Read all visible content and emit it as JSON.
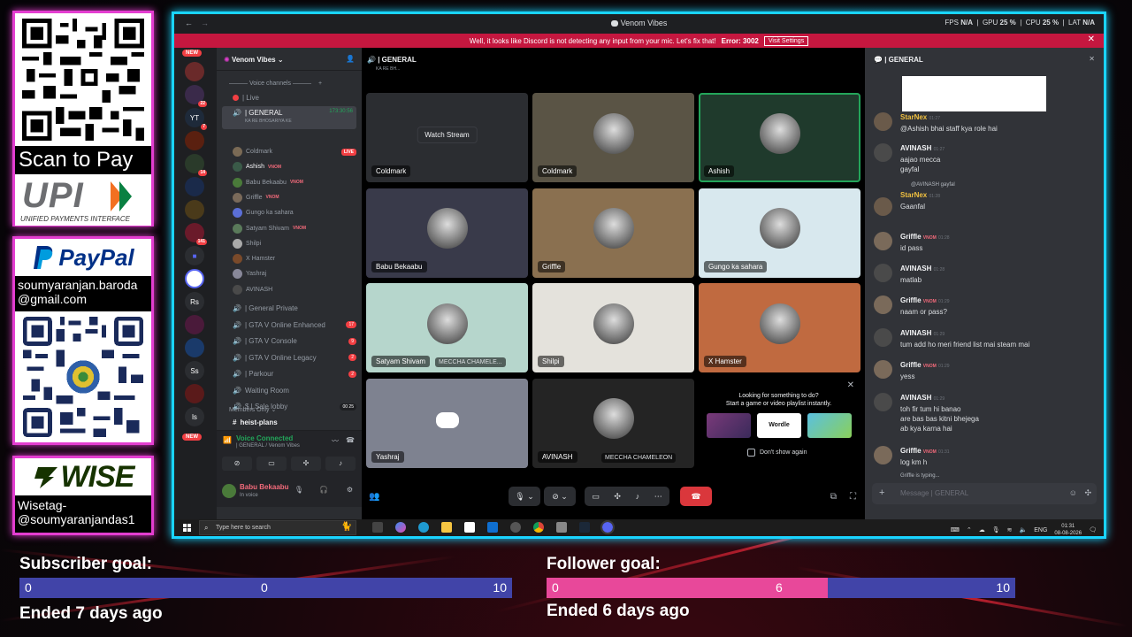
{
  "overlay": {
    "scan_to_pay": "Scan to Pay",
    "upi_logo": "UPI",
    "upi_sub": "UNIFIED PAYMENTS INTERFACE",
    "paypal_logo": "PayPal",
    "paypal_email_1": "soumyaranjan.baroda",
    "paypal_email_2": "@gmail.com",
    "wise_logo": "WISE",
    "wise_tag_1": "Wisetag-",
    "wise_tag_2": "@soumyaranjandas1",
    "subscriber": {
      "title": "Subscriber goal:",
      "start": "0",
      "current": "0",
      "target": "10",
      "progress": 0,
      "ended": "Ended 7 days ago"
    },
    "follower": {
      "title": "Follower goal:",
      "start": "0",
      "current": "6",
      "target": "10",
      "progress": 0.6,
      "ended": "Ended 6 days ago"
    },
    "colors": {
      "border_pink": "#e33dd0",
      "border_cyan": "#1ad4ff",
      "goal_fill": "#e8489a",
      "goal_track": "#4144a8"
    }
  },
  "discord": {
    "window_title": "Venom Vibes",
    "stats": {
      "fps_label": "FPS",
      "fps": "N/A",
      "gpu_label": "GPU",
      "gpu": "25 %",
      "cpu_label": "CPU",
      "cpu": "25 %",
      "lat_label": "LAT",
      "lat": "N/A"
    },
    "warning": {
      "text": "Well, it looks like Discord is not detecting any input from your mic. Let's fix that!",
      "error": "Error: 3002",
      "button": "Visit Settings"
    },
    "server_name": "Venom Vibes",
    "new_badge": "NEW",
    "guild_badges": [
      "22",
      "7",
      "14",
      "141"
    ],
    "guild_initials": [
      "Rs",
      "Ss",
      "ls"
    ],
    "category": "Voice channels",
    "channels": [
      {
        "name": "| Live"
      },
      {
        "name": "| GENERAL",
        "time": "173:30:56",
        "desc": "KA RE BHOSARIYA KE"
      }
    ],
    "live_badge": "LIVE",
    "members": [
      {
        "name": "Coldmark",
        "tag": "",
        "color": "#7a6a55"
      },
      {
        "name": "Ashish",
        "tag": "VNOM",
        "color": "#3a5a48"
      },
      {
        "name": "Babu Bekaabu",
        "tag": "VNOM",
        "color": "#4a7a3a"
      },
      {
        "name": "Griffle",
        "tag": "VNOM",
        "color": "#7a6a5a"
      },
      {
        "name": "Gungo ka sahara",
        "tag": "",
        "color": "#5b6fd6"
      },
      {
        "name": "Satyam Shivam",
        "tag": "VNOM",
        "color": "#5a7a5a"
      },
      {
        "name": "Shilpi",
        "tag": "",
        "color": "#aaaaaa"
      },
      {
        "name": "X Hamster",
        "tag": "",
        "color": "#7a4a2a"
      },
      {
        "name": "Yashraj",
        "tag": "",
        "color": "#888899"
      },
      {
        "name": "AVINASH",
        "tag": "",
        "color": "#4a4a4a"
      }
    ],
    "more_channels": [
      {
        "name": "| General Private",
        "count": ""
      },
      {
        "name": "| GTA V Online Enhanced",
        "count": "17"
      },
      {
        "name": "| GTA V Console",
        "count": "9"
      },
      {
        "name": "| GTA V Online Legacy",
        "count": "2"
      },
      {
        "name": "| Parkour",
        "count": "2"
      },
      {
        "name": "Waiting Room",
        "count": ""
      },
      {
        "name": "$ | Sale lobby",
        "count": "00  25"
      }
    ],
    "members_only": "Members Only",
    "heist_plans": "heist-plans",
    "voice_connected": "Voice Connected",
    "voice_sub": "| GENERAL / Venom Vibes",
    "user_name": "Babu Bekaabu",
    "user_status": "In voice",
    "stage_channel": "| GENERAL",
    "stage_desc": "KA RE BH...",
    "tiles": [
      {
        "name": "Coldmark",
        "watch": "Watch Stream",
        "bg": "#2b2d31"
      },
      {
        "name": "Coldmark",
        "bg": "#5a5445"
      },
      {
        "name": "Ashish",
        "bg": "#1f3a2c"
      },
      {
        "name": "Babu Bekaabu",
        "bg": "#393a4a"
      },
      {
        "name": "Griffle",
        "bg": "#8a7050"
      },
      {
        "name": "Gungo ka sahara",
        "bg": "#d8e8ee"
      },
      {
        "name": "Satyam Shivam",
        "extra": "MECCHA CHAMELE...",
        "bg": "#b6d6cc"
      },
      {
        "name": "Shilpi",
        "bg": "#e4e2dc"
      },
      {
        "name": "X Hamster",
        "bg": "#c06a40"
      },
      {
        "name": "Yashraj",
        "bg": "#7e8290"
      },
      {
        "name": "AVINASH",
        "extra": "MECCHA CHAMELEON",
        "bg": "#242424"
      }
    ],
    "activity": {
      "line1": "Looking for something to do?",
      "line2": "Start a game or video playlist instantly.",
      "wordle": "Wordle",
      "dont_show": "Don't show again"
    },
    "chat_title": "| GENERAL",
    "messages": [
      {
        "name": "StarNex",
        "time": "01:27",
        "lines": [
          "@Ashish bhai staff kya role hai"
        ],
        "name_color": "#f0c040",
        "av": "#6a5a4a"
      },
      {
        "name": "AVINASH",
        "time": "01:27",
        "lines": [
          "aajao mecca",
          "gayfal"
        ],
        "name_color": "#f2f3f5",
        "av": "#4a4a4a"
      },
      {
        "name": "StarNex",
        "time": "01:28",
        "reply": "@AVINASH gayfal",
        "lines": [
          "Gaanfal"
        ],
        "name_color": "#f0c040",
        "av": "#6a5a4a"
      },
      {
        "name": "Griffle",
        "tag": "VNOM",
        "time": "01:28",
        "lines": [
          "id pass"
        ],
        "name_color": "#f2f3f5",
        "av": "#7a6a5a"
      },
      {
        "name": "AVINASH",
        "time": "01:28",
        "lines": [
          "matlab"
        ],
        "name_color": "#f2f3f5",
        "av": "#4a4a4a"
      },
      {
        "name": "Griffle",
        "tag": "VNOM",
        "time": "01:29",
        "lines": [
          "naam or pass?"
        ],
        "name_color": "#f2f3f5",
        "av": "#7a6a5a"
      },
      {
        "name": "AVINASH",
        "time": "01:29",
        "lines": [
          "tum add ho meri friend list mai steam mai"
        ],
        "name_color": "#f2f3f5",
        "av": "#4a4a4a"
      },
      {
        "name": "Griffle",
        "tag": "VNOM",
        "time": "01:29",
        "lines": [
          "yess"
        ],
        "name_color": "#f2f3f5",
        "av": "#7a6a5a"
      },
      {
        "name": "AVINASH",
        "time": "01:29",
        "lines": [
          "toh fir tum hi banao",
          "are bas bas kitni bhejega",
          "ab kya karna hai"
        ],
        "name_color": "#f2f3f5",
        "av": "#4a4a4a"
      },
      {
        "name": "Griffle",
        "tag": "VNOM",
        "time": "01:31",
        "lines": [
          "log km h"
        ],
        "name_color": "#f2f3f5",
        "av": "#7a6a5a"
      }
    ],
    "typing": "Griffle is typing...",
    "chat_placeholder": "Message | GENERAL",
    "taskbar": {
      "search": "Type here to search",
      "lang": "ENG",
      "time": "01:31",
      "date": "08-08-2026"
    }
  }
}
